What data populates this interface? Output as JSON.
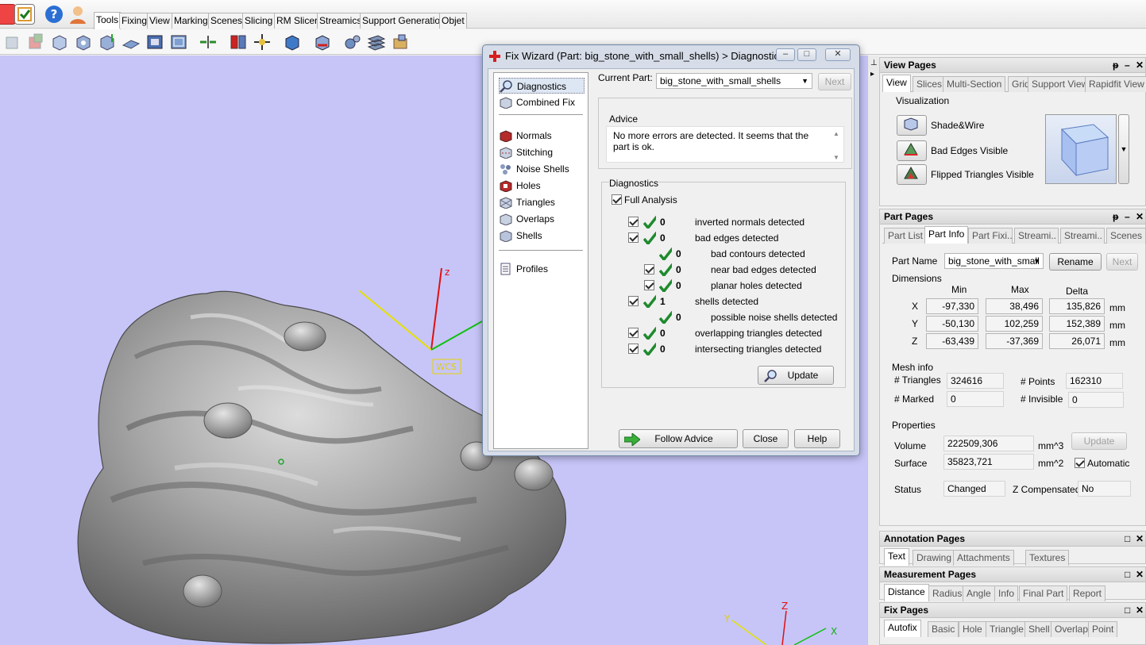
{
  "ribbon": {
    "tabs": [
      "Tools",
      "Fixing",
      "View",
      "Marking",
      "Scenes",
      "Slicing",
      "RM Slicer",
      "Streamics",
      "Support Generation",
      "Objet"
    ],
    "active_tab": "Tools"
  },
  "viewport": {
    "axis_z": "z",
    "wcs_label": "WCS",
    "corner_y": "Y",
    "corner_z": "Z",
    "corner_x": "X"
  },
  "dialog": {
    "title": "Fix Wizard (Part: big_stone_with_small_shells) > Diagnostics",
    "nav": {
      "diagnostics": "Diagnostics",
      "combined_fix": "Combined Fix",
      "normals": "Normals",
      "stitching": "Stitching",
      "noise_shells": "Noise Shells",
      "holes": "Holes",
      "triangles": "Triangles",
      "overlaps": "Overlaps",
      "shells": "Shells",
      "profiles": "Profiles"
    },
    "current_part_label": "Current Part:",
    "current_part_value": "big_stone_with_small_shells",
    "next_label": "Next",
    "advice_label": "Advice",
    "advice_text": "No more errors are detected. It seems that the part is ok.",
    "diagnostics_label": "Diagnostics",
    "full_analysis_label": "Full Analysis",
    "rows": [
      {
        "count": "0",
        "text": "inverted normals detected"
      },
      {
        "count": "0",
        "text": "bad edges detected"
      },
      {
        "count": "0",
        "text": "bad contours detected"
      },
      {
        "count": "0",
        "text": "near bad edges detected"
      },
      {
        "count": "0",
        "text": "planar holes detected"
      },
      {
        "count": "1",
        "text": "shells detected"
      },
      {
        "count": "0",
        "text": "possible noise shells detected"
      },
      {
        "count": "0",
        "text": "overlapping triangles detected"
      },
      {
        "count": "0",
        "text": "intersecting triangles detected"
      }
    ],
    "update_label": "Update",
    "follow_advice_label": "Follow Advice",
    "close_label": "Close",
    "help_label": "Help"
  },
  "view_pages": {
    "title": "View Pages",
    "tabs": [
      "View",
      "Slices",
      "Multi-Section",
      "Grid",
      "Support View",
      "Rapidfit View"
    ],
    "visualization_label": "Visualization",
    "shade_wire": "Shade&Wire",
    "bad_edges_visible": "Bad Edges Visible",
    "flipped_triangles_visible": "Flipped Triangles Visible"
  },
  "part_pages": {
    "title": "Part Pages",
    "tabs": [
      "Part List",
      "Part Info",
      "Part Fixi..",
      "Streami..",
      "Streami..",
      "Scenes"
    ],
    "part_name_label": "Part Name",
    "part_name_value": "big_stone_with_small",
    "rename_label": "Rename",
    "next_label": "Next",
    "dimensions_label": "Dimensions",
    "col_min": "Min",
    "col_max": "Max",
    "col_delta": "Delta",
    "unit_mm": "mm",
    "dims": [
      {
        "axis": "X",
        "min": "-97,330",
        "max": "38,496",
        "delta": "135,826"
      },
      {
        "axis": "Y",
        "min": "-50,130",
        "max": "102,259",
        "delta": "152,389"
      },
      {
        "axis": "Z",
        "min": "-63,439",
        "max": "-37,369",
        "delta": "26,071"
      }
    ],
    "mesh_info_label": "Mesh info",
    "triangles_label": "# Triangles",
    "triangles_value": "324616",
    "points_label": "# Points",
    "points_value": "162310",
    "marked_label": "# Marked",
    "marked_value": "0",
    "invisible_label": "# Invisible",
    "invisible_value": "0",
    "properties_label": "Properties",
    "volume_label": "Volume",
    "volume_value": "222509,306",
    "volume_unit": "mm^3",
    "surface_label": "Surface",
    "surface_value": "35823,721",
    "surface_unit": "mm^2",
    "update_label": "Update",
    "automatic_label": "Automatic",
    "status_label": "Status",
    "status_value": "Changed",
    "z_comp_label": "Z Compensated",
    "z_comp_value": "No"
  },
  "annotation_pages": {
    "title": "Annotation Pages",
    "tabs": [
      "Text",
      "Drawing",
      "Attachments",
      "Textures"
    ]
  },
  "measurement_pages": {
    "title": "Measurement Pages",
    "tabs": [
      "Distance",
      "Radius",
      "Angle",
      "Info",
      "Final Part",
      "Report"
    ]
  },
  "fix_pages": {
    "title": "Fix Pages",
    "tabs": [
      "Autofix",
      "Basic",
      "Hole",
      "Triangle",
      "Shell",
      "Overlap",
      "Point"
    ]
  },
  "colors": {
    "viewport_bg": "#c7c5f7",
    "check_green": "#1f8a2e",
    "mesh_grey": "#8e8e8e"
  }
}
